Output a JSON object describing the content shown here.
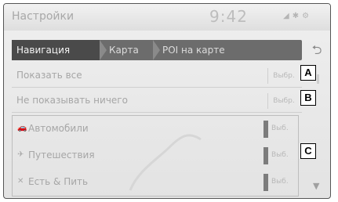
{
  "status": {
    "title": "Настройки",
    "time": "9:42",
    "icons": [
      "signal-icon",
      "bluetooth-icon",
      "settings-icon"
    ]
  },
  "breadcrumb": {
    "items": [
      "Навигация",
      "Карта",
      "POI на карте"
    ]
  },
  "options": {
    "show_all": "Показать все",
    "show_nothing": "Не показывать ничего",
    "action": "Выбр."
  },
  "categories": [
    {
      "label": "Автомобили",
      "icon": "car-icon",
      "action": "Выб."
    },
    {
      "label": "Путешествия",
      "icon": "travel-icon",
      "action": "Выб."
    },
    {
      "label": "Есть & Пить",
      "icon": "food-icon",
      "action": "Выб."
    }
  ],
  "callouts": {
    "a": "A",
    "b": "B",
    "c": "C"
  },
  "colors": {
    "breadcrumb_active": "#4a4a4a",
    "breadcrumb": "#6c6c6c",
    "background": "#e8e8e8"
  }
}
